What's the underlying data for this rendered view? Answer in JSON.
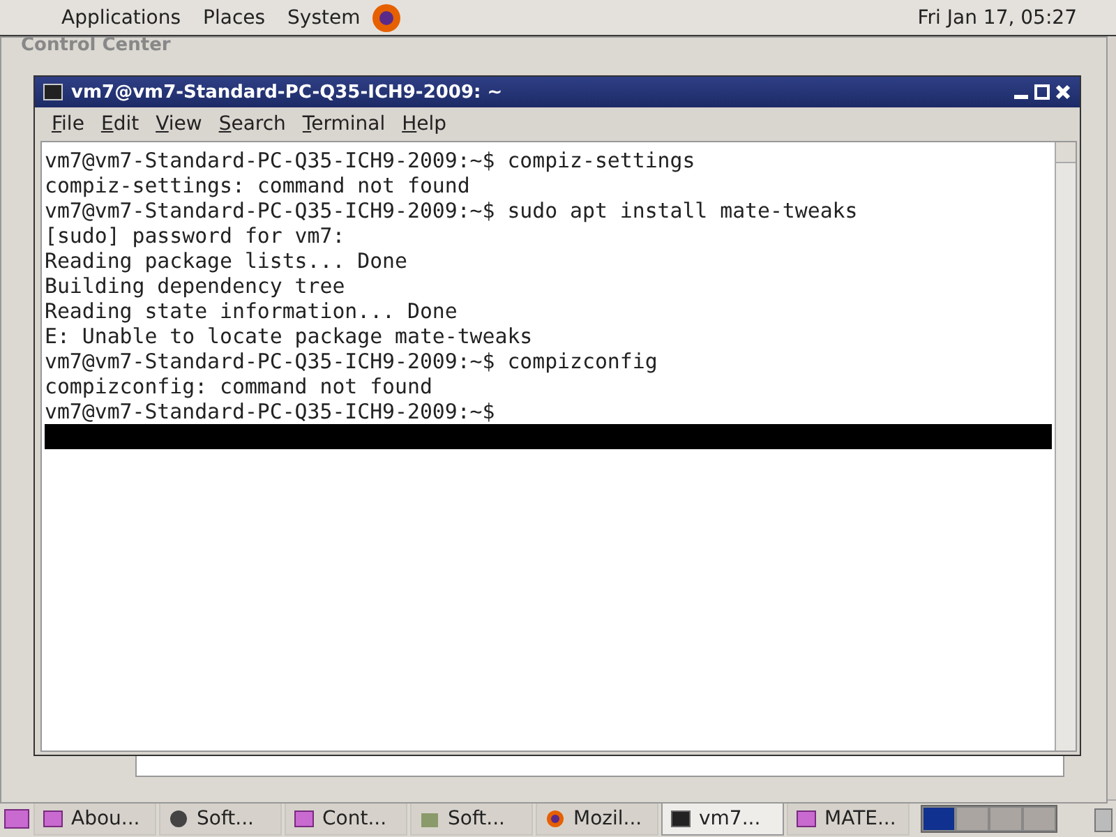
{
  "top_panel": {
    "menus": [
      "Applications",
      "Places",
      "System"
    ],
    "clock": "Fri Jan 17, 05:27"
  },
  "background_window": {
    "title": "Control Center"
  },
  "terminal_window": {
    "title": "vm7@vm7-Standard-PC-Q35-ICH9-2009: ~",
    "menu": [
      "File",
      "Edit",
      "View",
      "Search",
      "Terminal",
      "Help"
    ],
    "lines": [
      "vm7@vm7-Standard-PC-Q35-ICH9-2009:~$ compiz-settings",
      "compiz-settings: command not found",
      "vm7@vm7-Standard-PC-Q35-ICH9-2009:~$ sudo apt install mate-tweaks",
      "[sudo] password for vm7:",
      "Reading package lists... Done",
      "Building dependency tree",
      "Reading state information... Done",
      "E: Unable to locate package mate-tweaks",
      "vm7@vm7-Standard-PC-Q35-ICH9-2009:~$ compizconfig",
      "compizconfig: command not found",
      "vm7@vm7-Standard-PC-Q35-ICH9-2009:~$"
    ]
  },
  "taskbar": {
    "tasks": [
      {
        "label": "Abou...",
        "kind": "window",
        "selected": false
      },
      {
        "label": "Soft...",
        "kind": "circle",
        "selected": false
      },
      {
        "label": "Cont...",
        "kind": "window",
        "selected": false
      },
      {
        "label": "Soft...",
        "kind": "box",
        "selected": false
      },
      {
        "label": "Mozil...",
        "kind": "browser",
        "selected": false
      },
      {
        "label": "vm7...",
        "kind": "terminal",
        "selected": true
      },
      {
        "label": "MATE...",
        "kind": "window",
        "selected": false
      }
    ],
    "workspaces": [
      {
        "selected": true
      },
      {
        "selected": false
      },
      {
        "selected": false
      },
      {
        "selected": false
      }
    ]
  }
}
